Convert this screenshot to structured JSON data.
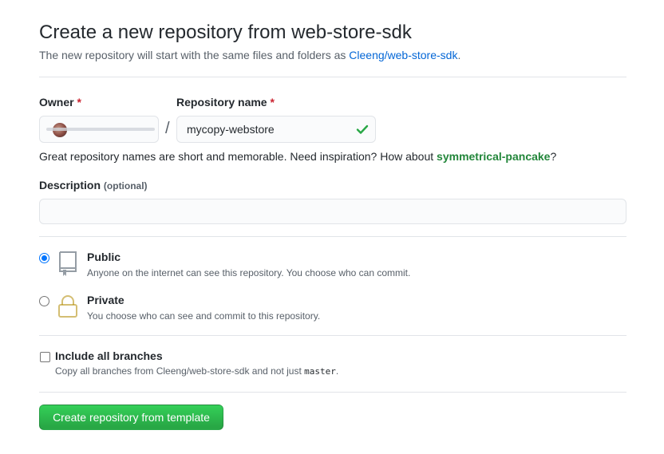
{
  "header": {
    "title": "Create a new repository from web-store-sdk",
    "subtitle_prefix": "The new repository will start with the same files and folders as ",
    "template_link": "Cleeng/web-store-sdk",
    "subtitle_suffix": "."
  },
  "owner": {
    "label": "Owner",
    "required_mark": "*"
  },
  "repo_name": {
    "label": "Repository name",
    "required_mark": "*",
    "value": "mycopy-webstore",
    "valid": true
  },
  "separator": "/",
  "hint": {
    "prefix": "Great repository names are short and memorable. Need inspiration? How about ",
    "suggestion": "symmetrical-pancake",
    "suffix": "?"
  },
  "description": {
    "label": "Description",
    "optional": "(optional)",
    "value": ""
  },
  "visibility": {
    "public": {
      "title": "Public",
      "desc": "Anyone on the internet can see this repository. You choose who can commit.",
      "selected": true,
      "icon": "repo-icon"
    },
    "private": {
      "title": "Private",
      "desc": "You choose who can see and commit to this repository.",
      "selected": false,
      "icon": "lock-icon"
    }
  },
  "branches": {
    "title": "Include all branches",
    "desc_prefix": "Copy all branches from Cleeng/web-store-sdk and not just ",
    "desc_code": "master",
    "desc_suffix": ".",
    "checked": false
  },
  "submit_label": "Create repository from template",
  "colors": {
    "accent_link": "#0366d6",
    "success": "#28a745",
    "required": "#cb2431",
    "suggestion": "#22863a"
  }
}
